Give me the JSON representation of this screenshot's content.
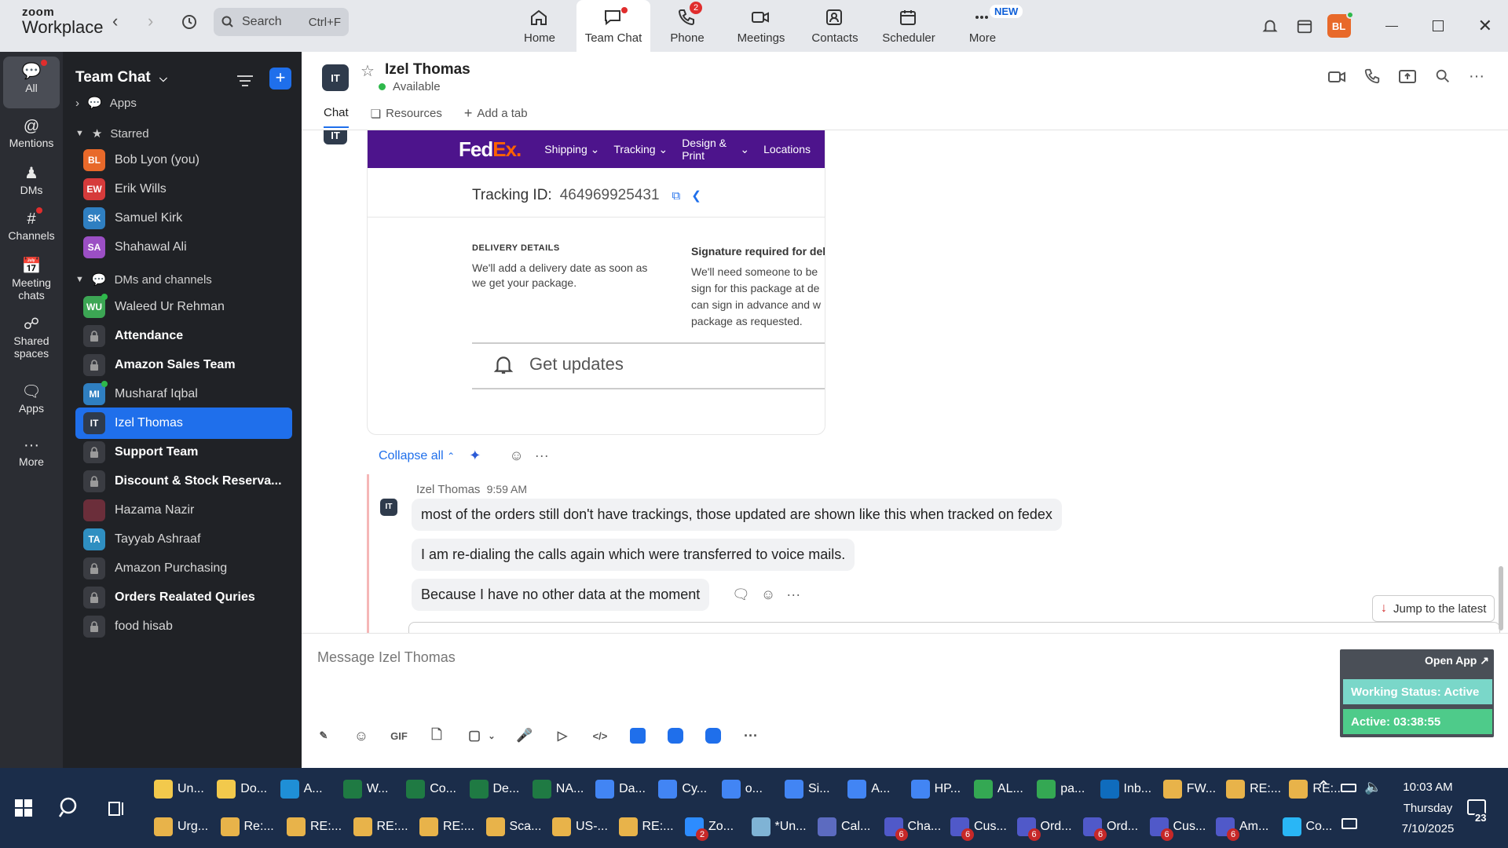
{
  "app": {
    "logo_top": "zoom",
    "logo_bottom": "Workplace"
  },
  "topbar": {
    "search_label": "Search",
    "search_shortcut": "Ctrl+F",
    "tabs": [
      {
        "label": "Home",
        "icon": "home-icon"
      },
      {
        "label": "Team Chat",
        "icon": "chat-icon",
        "active": true
      },
      {
        "label": "Phone",
        "icon": "phone-icon",
        "badge": "2"
      },
      {
        "label": "Meetings",
        "icon": "video-camera-icon"
      },
      {
        "label": "Contacts",
        "icon": "contacts-icon"
      },
      {
        "label": "Scheduler",
        "icon": "calendar-icon"
      },
      {
        "label": "More",
        "icon": "more-icon",
        "new": "NEW"
      }
    ],
    "avatar": "BL"
  },
  "rail": [
    {
      "label": "All",
      "icon": "chat-bubble-icon"
    },
    {
      "label": "Mentions",
      "icon": "at-icon"
    },
    {
      "label": "DMs",
      "icon": "people-icon"
    },
    {
      "label": "Channels",
      "icon": "hash-icon"
    },
    {
      "label": "Meeting chats",
      "icon": "calendar-icon"
    },
    {
      "label": "Shared spaces",
      "icon": "shared-icon"
    },
    {
      "label": "Apps",
      "icon": "apps-icon"
    },
    {
      "label": "More",
      "icon": "ellipsis-icon"
    }
  ],
  "sidebar": {
    "title": "Team Chat",
    "apps_label": "Apps",
    "starred_label": "Starred",
    "dms_label": "DMs and channels",
    "starred": [
      {
        "initials": "BL",
        "name": "Bob Lyon (you)",
        "color": "#e8692a"
      },
      {
        "initials": "EW",
        "name": "Erik Wills",
        "color": "#d63b3b"
      },
      {
        "initials": "SK",
        "name": "Samuel Kirk",
        "color": "#2f7fc1"
      },
      {
        "initials": "SA",
        "name": "Shahawal Ali",
        "color": "#9b4fc4"
      }
    ],
    "channels": [
      {
        "initials": "WU",
        "name": "Waleed Ur Rehman",
        "color": "#3ca654",
        "type": "dm"
      },
      {
        "name": "Attendance",
        "type": "lock",
        "bold": true
      },
      {
        "name": "Amazon Sales Team",
        "type": "lock",
        "bold": true
      },
      {
        "initials": "MI",
        "name": "Musharaf Iqbal",
        "color": "#2f7fc1",
        "type": "dm"
      },
      {
        "initials": "IT",
        "name": "Izel Thomas",
        "color": "#2f3b4c",
        "type": "dm",
        "selected": true
      },
      {
        "name": "Support Team",
        "type": "lock",
        "bold": true
      },
      {
        "name": "Discount & Stock Reserva...",
        "type": "lock",
        "bold": true
      },
      {
        "initials": "",
        "name": "Hazama Nazir",
        "color": "#6b2e3a",
        "type": "dm"
      },
      {
        "initials": "TA",
        "name": "Tayyab Ashraaf",
        "color": "#2f8fc1",
        "type": "dm"
      },
      {
        "name": "Amazon Purchasing",
        "type": "lock"
      },
      {
        "name": "Orders Realated Quries",
        "type": "lock",
        "bold": true
      },
      {
        "name": "food hisab",
        "type": "lock"
      }
    ]
  },
  "channel": {
    "avatar": "IT",
    "name": "Izel Thomas",
    "status": "Available",
    "tabs": [
      "Chat",
      "Resources",
      "Add a tab"
    ]
  },
  "fedex": {
    "logo_a": "Fed",
    "logo_b": "Ex.",
    "nav": [
      "Shipping",
      "Tracking",
      "Design & Print",
      "Locations"
    ],
    "tracking_label": "Tracking ID:",
    "tracking_id": "464969925431",
    "delivery_title": "DELIVERY DETAILS",
    "delivery_text_1": "We'll add a delivery date as soon as",
    "delivery_text_2": "we get your package.",
    "sig_title": "Signature required for deli",
    "sig_1": "We'll need someone to be",
    "sig_2": "sign for this package at de",
    "sig_3": "can sign in advance and w",
    "sig_4": "package as requested.",
    "updates": "Get updates"
  },
  "thread": {
    "avatar_top": "IT",
    "collapse": "Collapse all",
    "sender": "Izel Thomas",
    "time": "9:59 AM",
    "avatar": "IT",
    "messages": [
      "most of the orders still don't have trackings, those updated are shown like this when tracked on fedex",
      "I am re-dialing the calls again which were transferred to voice mails.",
      "Because I have no other data at the moment"
    ],
    "jump": "Jump to the latest"
  },
  "composer": {
    "placeholder": "Message Izel Thomas",
    "gif": "GIF"
  },
  "widget": {
    "open_app": "Open App",
    "working_status": "Working Status: Active",
    "active_time": "Active: 03:38:55"
  },
  "taskbar": {
    "row1": [
      {
        "label": "Un...",
        "color": "#f2c94c"
      },
      {
        "label": "Do...",
        "color": "#f2c94c"
      },
      {
        "label": "A...",
        "color": "#1f8fd6"
      },
      {
        "label": "W...",
        "color": "#1f7a43"
      },
      {
        "label": "Co...",
        "color": "#1f7a43"
      },
      {
        "label": "De...",
        "color": "#1f7a43"
      },
      {
        "label": "NA...",
        "color": "#1f7a43"
      },
      {
        "label": "Da...",
        "color": "#4285f4"
      },
      {
        "label": "Cy...",
        "color": "#4285f4"
      },
      {
        "label": "o...",
        "color": "#4285f4"
      },
      {
        "label": "Si...",
        "color": "#4285f4"
      },
      {
        "label": "A...",
        "color": "#4285f4"
      },
      {
        "label": "HP...",
        "color": "#4285f4"
      },
      {
        "label": "AL...",
        "color": "#34a853"
      },
      {
        "label": "pa...",
        "color": "#34a853"
      },
      {
        "label": "Inb...",
        "color": "#0f6cbd"
      },
      {
        "label": "FW...",
        "color": "#e8b34a"
      },
      {
        "label": "RE:...",
        "color": "#e8b34a"
      },
      {
        "label": "RE:...",
        "color": "#e8b34a"
      }
    ],
    "row2": [
      {
        "label": "Urg...",
        "color": "#e8b34a"
      },
      {
        "label": "Re:...",
        "color": "#e8b34a"
      },
      {
        "label": "RE:...",
        "color": "#e8b34a"
      },
      {
        "label": "RE:...",
        "color": "#e8b34a"
      },
      {
        "label": "RE:...",
        "color": "#e8b34a"
      },
      {
        "label": "Sca...",
        "color": "#e8b34a"
      },
      {
        "label": "US-...",
        "color": "#e8b34a"
      },
      {
        "label": "RE:...",
        "color": "#e8b34a"
      },
      {
        "label": "Zo...",
        "color": "#2d8cff",
        "badge": "2"
      },
      {
        "label": "*Un...",
        "color": "#7fb3d5"
      },
      {
        "label": "Cal...",
        "color": "#5c6bc0"
      },
      {
        "label": "Cha...",
        "color": "#5059c9",
        "badge": "6"
      },
      {
        "label": "Cus...",
        "color": "#5059c9",
        "badge": "6"
      },
      {
        "label": "Ord...",
        "color": "#5059c9",
        "badge": "6"
      },
      {
        "label": "Ord...",
        "color": "#5059c9",
        "badge": "6"
      },
      {
        "label": "Cus...",
        "color": "#5059c9",
        "badge": "6"
      },
      {
        "label": "Am...",
        "color": "#5059c9",
        "badge": "6"
      },
      {
        "label": "Co...",
        "color": "#29b6f6"
      }
    ],
    "time": "10:03 AM",
    "day": "Thursday",
    "date": "7/10/2025",
    "notif_count": "23"
  }
}
